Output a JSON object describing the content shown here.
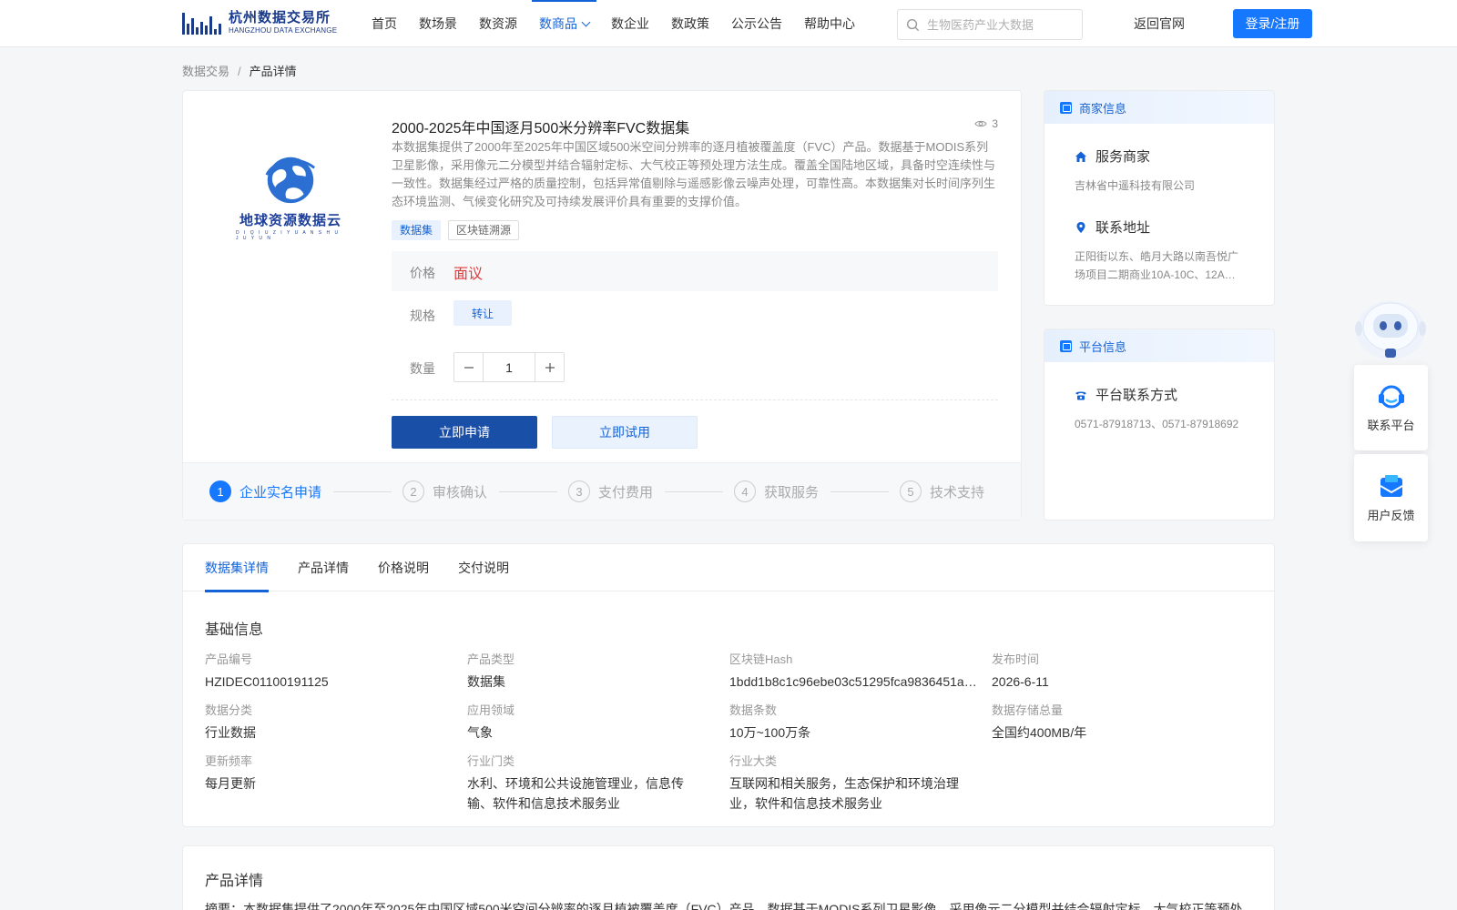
{
  "header": {
    "logo_cn": "杭州数据交易所",
    "logo_en": "HANGZHOU DATA EXCHANGE",
    "nav": [
      {
        "label": "首页"
      },
      {
        "label": "数场景"
      },
      {
        "label": "数资源"
      },
      {
        "label": "数商品",
        "active": true
      },
      {
        "label": "数企业"
      },
      {
        "label": "数政策"
      },
      {
        "label": "公示公告"
      },
      {
        "label": "帮助中心"
      }
    ],
    "search_placeholder": "生物医药产业大数据",
    "back_label": "返回官网",
    "login_label": "登录/注册",
    "accent_color": "#1677ff"
  },
  "breadcrumb": {
    "root": "数据交易",
    "sep": "/",
    "current": "产品详情"
  },
  "product": {
    "logo_name": "地球资源数据云",
    "logo_sub": "D I Q I U Z I Y U A N S H U J U Y U N",
    "title": "2000-2025年中国逐月500米分辨率FVC数据集",
    "views": "3",
    "description": "本数据集提供了2000年至2025年中国区域500米空间分辨率的逐月植被覆盖度（FVC）产品。数据基于MODIS系列卫星影像，采用像元二分模型并结合辐射定标、大气校正等预处理方法生成。覆盖全国陆地区域，具备时空连续性与一致性。数据集经过严格的质量控制，包括异常值剔除与遥感影像云噪声处理，可靠性高。本数据集对长时间序列生态环境监测、气候变化研究及可持续发展评价具有重要的支撑价值。",
    "tags": [
      "数据集",
      "区块链溯源"
    ],
    "price_label": "价格",
    "price_value": "面议",
    "spec_label": "规格",
    "spec_value": "转让",
    "qty_label": "数量",
    "qty_value": "1",
    "apply_label": "立即申请",
    "trial_label": "立即试用",
    "price_color": "#e03a3a"
  },
  "steps": [
    {
      "num": "1",
      "label": "企业实名申请",
      "active": true
    },
    {
      "num": "2",
      "label": "审核确认"
    },
    {
      "num": "3",
      "label": "支付费用"
    },
    {
      "num": "4",
      "label": "获取服务"
    },
    {
      "num": "5",
      "label": "技术支持"
    }
  ],
  "merchant": {
    "title": "商家信息",
    "service_label": "服务商家",
    "service_value": "吉林省中遥科技有限公司",
    "address_label": "联系地址",
    "address_value": "正阳街以东、皓月大路以南吾悦广场项目二期商业10A-10C、12A…"
  },
  "platform": {
    "title": "平台信息",
    "contact_label": "平台联系方式",
    "contact_value": "0571-87918713、0571-87918692"
  },
  "floating": {
    "contact_label": "联系平台",
    "feedback_label": "用户反馈"
  },
  "tabs": [
    {
      "label": "数据集详情",
      "active": true
    },
    {
      "label": "产品详情"
    },
    {
      "label": "价格说明"
    },
    {
      "label": "交付说明"
    }
  ],
  "basic_info": {
    "title": "基础信息",
    "fields": [
      {
        "label": "产品编号",
        "value": "HZIDEC01100191125"
      },
      {
        "label": "产品类型",
        "value": "数据集"
      },
      {
        "label": "区块链Hash",
        "value": "1bdd1b8c1c96ebe03c51295fca9836451a…"
      },
      {
        "label": "发布时间",
        "value": "2026-6-11"
      },
      {
        "label": "数据分类",
        "value": "行业数据"
      },
      {
        "label": "应用领域",
        "value": "气象"
      },
      {
        "label": "数据条数",
        "value": "10万~100万条"
      },
      {
        "label": "数据存储总量",
        "value": "全国约400MB/年"
      },
      {
        "label": "更新频率",
        "value": "每月更新"
      },
      {
        "label": "行业门类",
        "value": "水利、环境和公共设施管理业，信息传输、软件和信息技术服务业"
      },
      {
        "label": "行业大类",
        "value": "互联网和相关服务，生态保护和环境治理业，软件和信息技术服务业"
      }
    ]
  },
  "product_detail": {
    "title": "产品详情",
    "abstract": "摘要：本数据集提供了2000年至2025年中国区域500米空间分辨率的逐月植被覆盖度（FVC）产品。数据基于MODIS系列卫星影像，采用像元二分模型并结合辐射定标、大气校正等预处"
  }
}
